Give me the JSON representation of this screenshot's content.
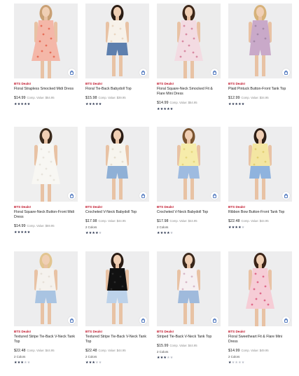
{
  "products": [
    {
      "badge": "BTS Deals!",
      "name": "Floral Strapless Smocked Midi Dress",
      "price": "$14.99",
      "comp": "Comp. Value: $54.95",
      "colors": "",
      "rating": 5,
      "photo": {
        "bg": "#ededee",
        "dress": "#f4b7a8",
        "pattern": "#e86f5a",
        "hair": "#c9a074"
      }
    },
    {
      "badge": "BTS Deals!",
      "name": "Floral Tie-Back Babydoll Top",
      "price": "$15.98",
      "comp": "Comp. Value: $39.95",
      "colors": "",
      "rating": 5,
      "photo": {
        "bg": "#ededee",
        "dress": "#f7f2ea",
        "pattern": "#e9d6c2",
        "hair": "#2a1c14",
        "pants": "#5d7fae"
      }
    },
    {
      "badge": "BTS Deals!",
      "name": "Floral Square-Neck Smocked Fit & Flare Mini Dress",
      "price": "$14.99",
      "comp": "Comp. Value: $54.95",
      "colors": "",
      "rating": 5,
      "photo": {
        "bg": "#ececec",
        "dress": "#f3dbe2",
        "pattern": "#d88aa3",
        "hair": "#3b2618"
      }
    },
    {
      "badge": "BTS Deals!",
      "name": "Plaid Pintuck Button-Front Tank Top",
      "price": "$12.99",
      "comp": "Comp. Value: $34.95",
      "colors": "",
      "rating": 5,
      "photo": {
        "bg": "#ededee",
        "dress": "#c9a9c9",
        "pattern": "#a58aa8",
        "hair": "#d6b27a",
        "pants": "#c9a9c9"
      }
    },
    {
      "badge": "BTS Deals!",
      "name": "Floral Square-Neck Button-Front Midi Dress",
      "price": "$14.99",
      "comp": "Comp. Value: $59.95",
      "colors": "",
      "rating": 5,
      "photo": {
        "bg": "#efefef",
        "dress": "#f8f7f3",
        "pattern": "#e8e4dc",
        "hair": "#3a2a1c"
      }
    },
    {
      "badge": "BTS Deals!",
      "name": "Crocheted V-Neck Babydoll Top",
      "price": "$17.98",
      "comp": "Comp. Value: $44.95",
      "colors": "2 Colors",
      "rating": 4,
      "photo": {
        "bg": "#ededee",
        "dress": "#f7f5ee",
        "pattern": "#e4ded0",
        "hair": "#2a1c14",
        "pants": "#8fb0d6"
      }
    },
    {
      "badge": "BTS Deals!",
      "name": "Crocheted V-Neck Babydoll Top",
      "price": "$17.98",
      "comp": "Comp. Value: $44.95",
      "colors": "2 Colors",
      "rating": 4,
      "photo": {
        "bg": "#ededee",
        "dress": "#f6ecaa",
        "pattern": "#e6d680",
        "hair": "#7a5430",
        "pants": "#9ebbe0"
      }
    },
    {
      "badge": "BTS Deals!",
      "name": "Ribbon Bow Button-Front Tank Top",
      "price": "$22.48",
      "comp": "Comp. Value: $44.95",
      "colors": "",
      "rating": 4,
      "photo": {
        "bg": "#ededee",
        "dress": "#f4e6a2",
        "pattern": "#e2cf73",
        "hair": "#2e1f16",
        "pants": "#8fb3de"
      }
    },
    {
      "badge": "BTS Deals!",
      "name": "Textured Stripe Tie-Back V-Neck Tank Top",
      "price": "$22.48",
      "comp": "Comp. Value: $44.95",
      "colors": "2 Colors",
      "rating": 3,
      "photo": {
        "bg": "#ededee",
        "dress": "#f5f2ee",
        "pattern": "#e6e0d8",
        "hair": "#e2c590",
        "pants": "#a9c4e2"
      }
    },
    {
      "badge": "BTS Deals!",
      "name": "Textured Stripe Tie-Back V-Neck Tank Top",
      "price": "$22.48",
      "comp": "Comp. Value: $44.95",
      "colors": "2 Colors",
      "rating": 3,
      "photo": {
        "bg": "#ededee",
        "dress": "#111111",
        "pattern": "#2a2a2a",
        "hair": "#2a1c14",
        "pants": "#bcd2ea"
      }
    },
    {
      "badge": "BTS Deals!",
      "name": "Striped Tie-Back V-Neck Tank Top",
      "price": "$15.99",
      "comp": "Comp. Value: $44.95",
      "colors": "2 Colors",
      "rating": 3,
      "photo": {
        "bg": "#ededee",
        "dress": "#f6f0f2",
        "pattern": "#d8b8c8",
        "hair": "#3a281c",
        "pants": "#9fbadc"
      }
    },
    {
      "badge": "BTS Deals!",
      "name": "Floral Sweetheart Fit & Flare Mini Dress",
      "price": "$14.99",
      "comp": "Comp. Value: $49.95",
      "colors": "2 Colors",
      "rating": 1,
      "photo": {
        "bg": "#ededee",
        "dress": "#f6cdd6",
        "pattern": "#e06c8c",
        "hair": "#3a2418"
      }
    }
  ],
  "theme": {
    "badge_color": "#c0152a",
    "star_on": "#1f2a44",
    "star_off": "#b9bdc7"
  }
}
